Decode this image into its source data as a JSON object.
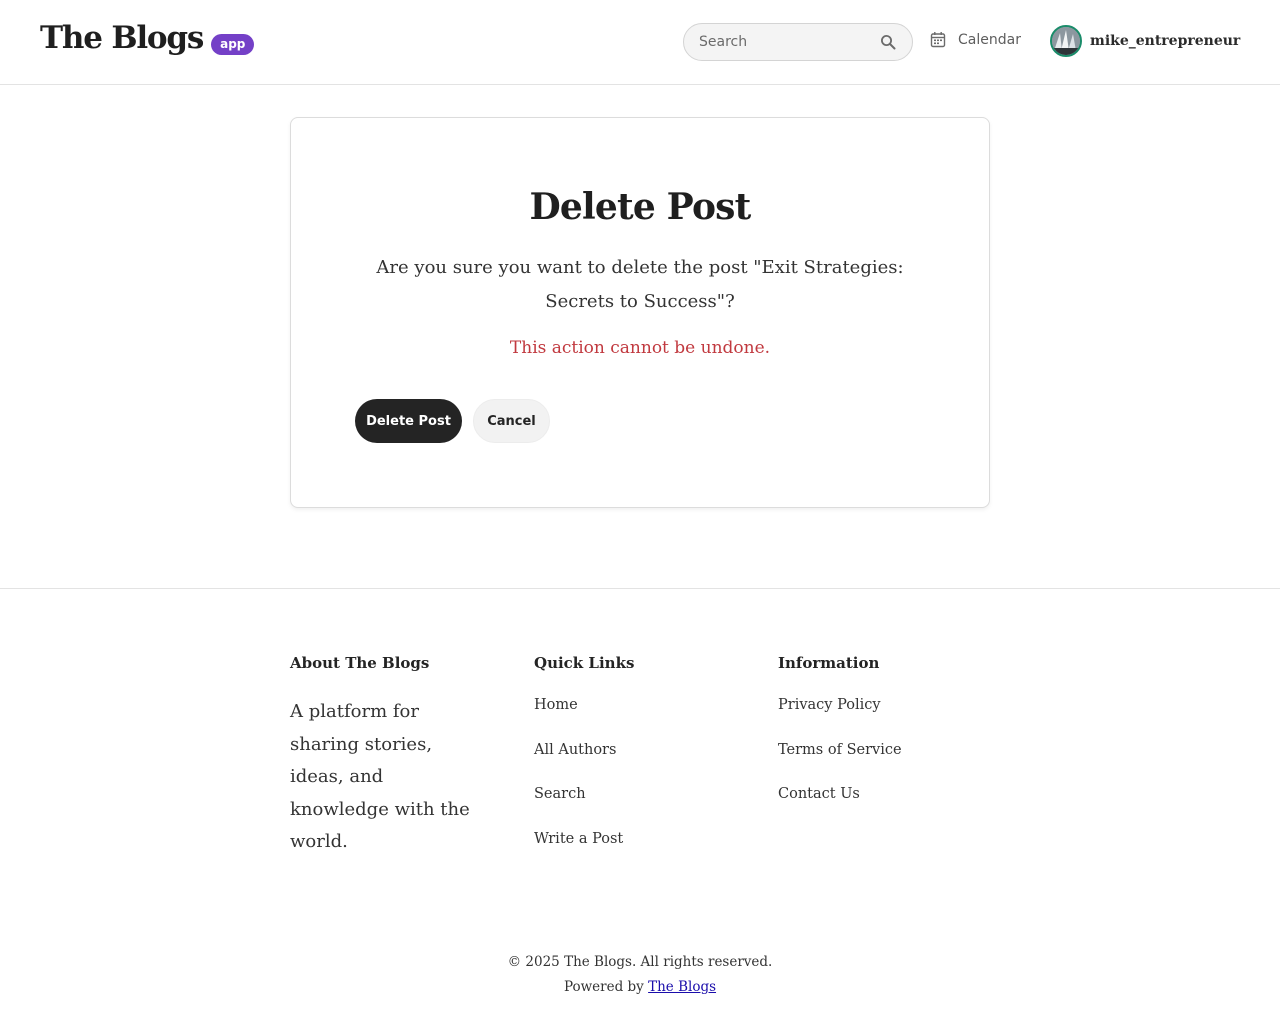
{
  "header": {
    "logo_text": "The Blogs",
    "logo_badge": "app",
    "search_placeholder": "Search",
    "calendar_label": "Calendar",
    "username": "mike_entrepreneur"
  },
  "dialog": {
    "title": "Delete Post",
    "message": "Are you sure you want to delete the post \"Exit Strategies: Secrets to Success\"?",
    "warning": "This action cannot be undone.",
    "delete_label": "Delete Post",
    "cancel_label": "Cancel"
  },
  "footer": {
    "about": {
      "heading": "About The Blogs",
      "text": "A platform for sharing stories, ideas, and knowledge with the world."
    },
    "quick_links": {
      "heading": "Quick Links",
      "items": [
        "Home",
        "All Authors",
        "Search",
        "Write a Post"
      ]
    },
    "information": {
      "heading": "Information",
      "items": [
        "Privacy Policy",
        "Terms of Service",
        "Contact Us"
      ]
    },
    "copyright": "© 2025 The Blogs. All rights reserved.",
    "powered_prefix": "Powered by",
    "powered_link": "The Blogs"
  },
  "colors": {
    "badge": "#7440c7",
    "danger_text": "#c1393f",
    "primary_button": "#242424",
    "avatar_ring": "#1a8c6a"
  },
  "icons": [
    "search-icon",
    "calendar-icon",
    "avatar"
  ]
}
